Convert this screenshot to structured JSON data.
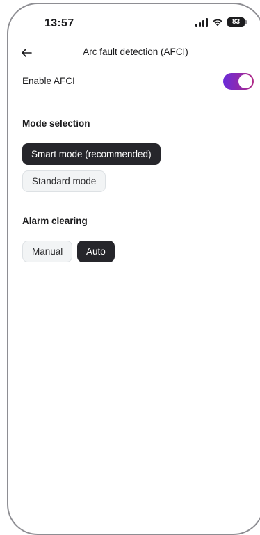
{
  "status_bar": {
    "time": "13:57",
    "battery": "83",
    "icons": [
      "signal-icon",
      "wifi-icon",
      "battery-icon"
    ]
  },
  "header": {
    "title": "Arc fault detection (AFCI)",
    "back_icon": "arrow-left-icon"
  },
  "afci": {
    "label": "Enable AFCI",
    "enabled": true,
    "toggle_colors": [
      "#6a2bd9",
      "#b02a86"
    ]
  },
  "mode_selection": {
    "title": "Mode selection",
    "options": [
      {
        "label": "Smart mode (recommended)",
        "selected": true
      },
      {
        "label": "Standard mode",
        "selected": false
      }
    ]
  },
  "alarm_clearing": {
    "title": "Alarm clearing",
    "options": [
      {
        "label": "Manual",
        "selected": false
      },
      {
        "label": "Auto",
        "selected": true
      }
    ]
  },
  "colors": {
    "selected_chip": "#26262b",
    "unselected_chip": "#f2f4f5"
  }
}
